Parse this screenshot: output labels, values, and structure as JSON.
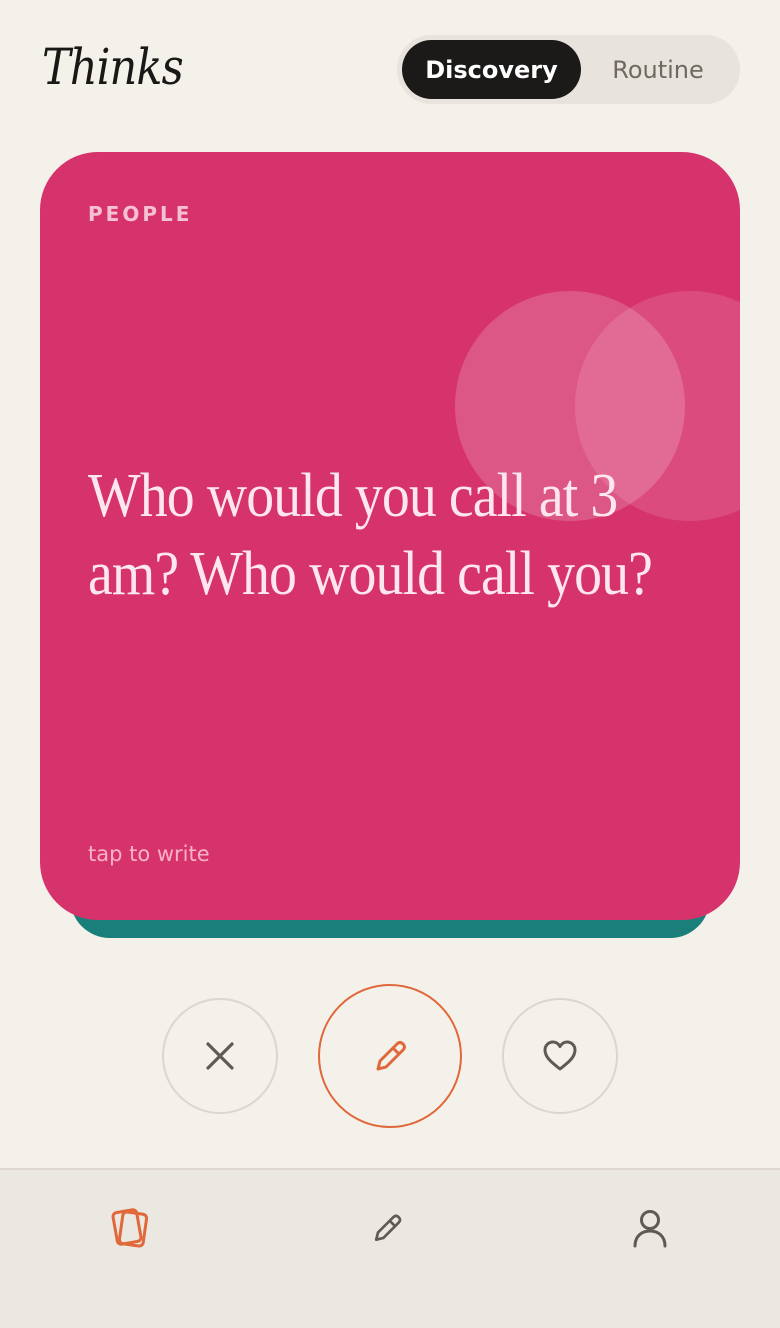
{
  "app": {
    "title": "Thinks"
  },
  "mode_toggle": {
    "options": [
      "Discovery",
      "Routine"
    ],
    "selected": "Discovery"
  },
  "card": {
    "category": "PEOPLE",
    "question": "Who would you call at 3 am? Who would call you?",
    "hint": "tap to write",
    "color": "#d6336c"
  },
  "actions": {
    "skip_icon": "close-icon",
    "write_icon": "pencil-icon",
    "like_icon": "heart-icon",
    "accent": "#e0683a"
  },
  "bottom_nav": {
    "items": [
      {
        "icon": "cards-icon",
        "active": true
      },
      {
        "icon": "pencil-icon",
        "active": false
      },
      {
        "icon": "user-icon",
        "active": false
      }
    ]
  }
}
